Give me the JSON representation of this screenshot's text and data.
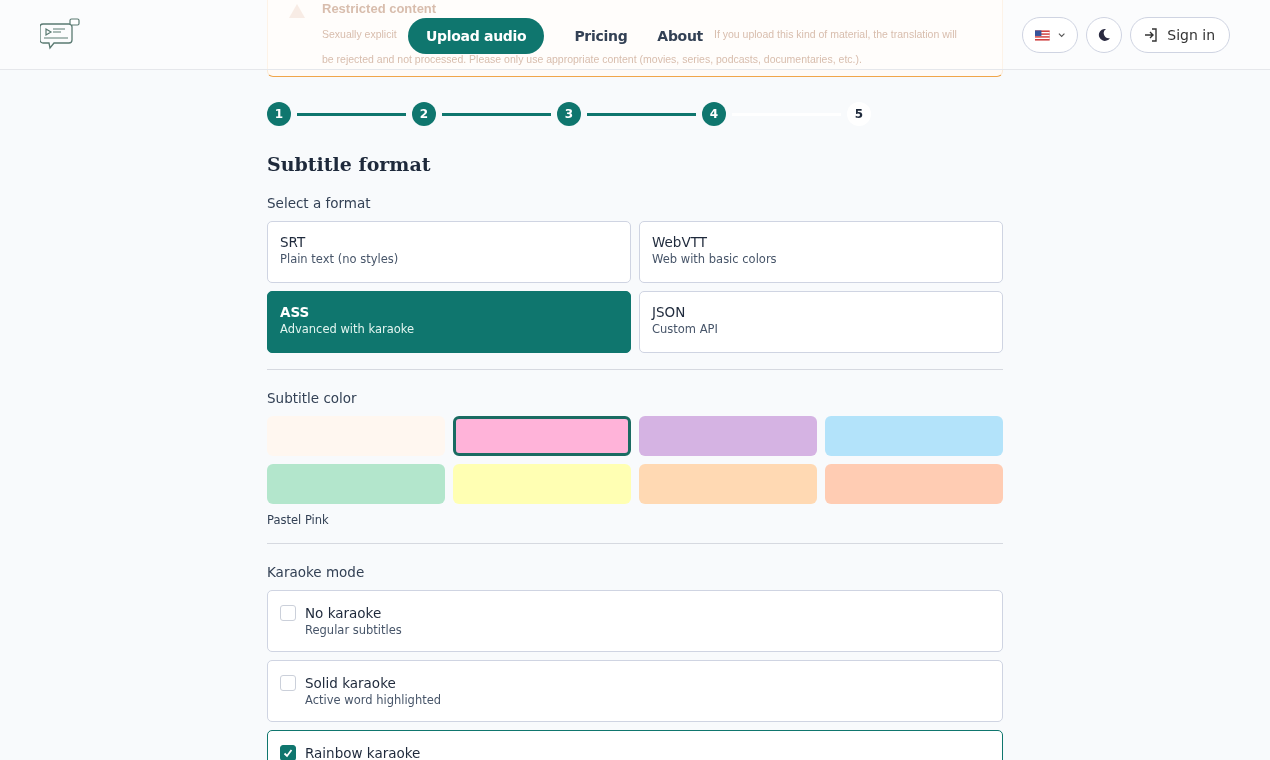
{
  "header": {
    "nav": [
      {
        "label": "Upload audio",
        "selected": true
      },
      {
        "label": "Pricing",
        "selected": false
      },
      {
        "label": "About",
        "selected": false
      }
    ],
    "sign_in": "Sign in"
  },
  "banner": {
    "title": "Restricted content",
    "line_1": [
      "Sexually explicit",
      "If you upload this kind of material, the translation will"
    ],
    "line_2": "be rejected and not processed. Please only use appropriate content (movies, series, podcasts, documentaries, etc.)."
  },
  "steps": [
    {
      "label": "1",
      "completed": true
    },
    {
      "label": "2",
      "completed": true
    },
    {
      "label": "3",
      "completed": true
    },
    {
      "label": "4",
      "completed": true
    },
    {
      "label": "5",
      "completed": false
    }
  ],
  "title": "Subtitle format",
  "format": {
    "label": "Select a format",
    "options": [
      {
        "name": "SRT",
        "description": "Plain text (no styles)",
        "selected": false
      },
      {
        "name": "WebVTT",
        "description": "Web with basic colors",
        "selected": false
      },
      {
        "name": "ASS",
        "description": "Advanced with karaoke",
        "selected": true
      },
      {
        "name": "JSON",
        "description": "Custom API",
        "selected": false
      }
    ]
  },
  "color": {
    "label": "Subtitle color",
    "swatches": [
      {
        "color": "#fff7f0",
        "selected": false
      },
      {
        "color": "#ffb3d9",
        "selected": true
      },
      {
        "color": "#d5b3e3",
        "selected": false
      },
      {
        "color": "#b3e3fa",
        "selected": false
      },
      {
        "color": "#b3e6cc",
        "selected": false
      },
      {
        "color": "#ffffb3",
        "selected": false
      },
      {
        "color": "#ffd9b3",
        "selected": false
      },
      {
        "color": "#ffccb3",
        "selected": false
      }
    ],
    "selected_name": "Pastel Pink"
  },
  "karaoke": {
    "label": "Karaoke mode",
    "options": [
      {
        "name": "No karaoke",
        "description": "Regular subtitles",
        "checked": false
      },
      {
        "name": "Solid karaoke",
        "description": "Active word highlighted",
        "checked": false
      },
      {
        "name": "Rainbow karaoke",
        "checked": true
      }
    ]
  }
}
